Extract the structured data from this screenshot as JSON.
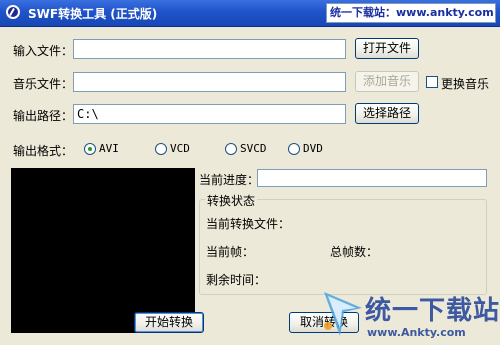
{
  "window": {
    "title": "SWF转换工具 (正式版)",
    "watermark": "统一下载站：www.ankty.com"
  },
  "inputs": {
    "input_file_label": "输入文件：",
    "input_file_value": "",
    "music_file_label": "音乐文件：",
    "music_file_value": "",
    "output_path_label": "输出路径：",
    "output_path_value": "C:\\"
  },
  "buttons": {
    "open_file": "打开文件",
    "add_music": "添加音乐",
    "change_music": "更换音乐",
    "select_path": "选择路径",
    "start_convert": "开始转换",
    "cancel_convert": "取消转换"
  },
  "format": {
    "label": "输出格式：",
    "options": [
      "AVI",
      "VCD",
      "SVCD",
      "DVD"
    ],
    "selected": "AVI"
  },
  "progress": {
    "label": "当前进度：",
    "value": ""
  },
  "status": {
    "group_title": "转换状态",
    "current_file_label": "当前转换文件：",
    "current_frame_label": "当前帧：",
    "total_frames_label": "总帧数：",
    "remaining_time_label": "剩余时间："
  },
  "branding": {
    "logo_text": "统一下载站",
    "logo_url": "www.Ankty.com"
  }
}
